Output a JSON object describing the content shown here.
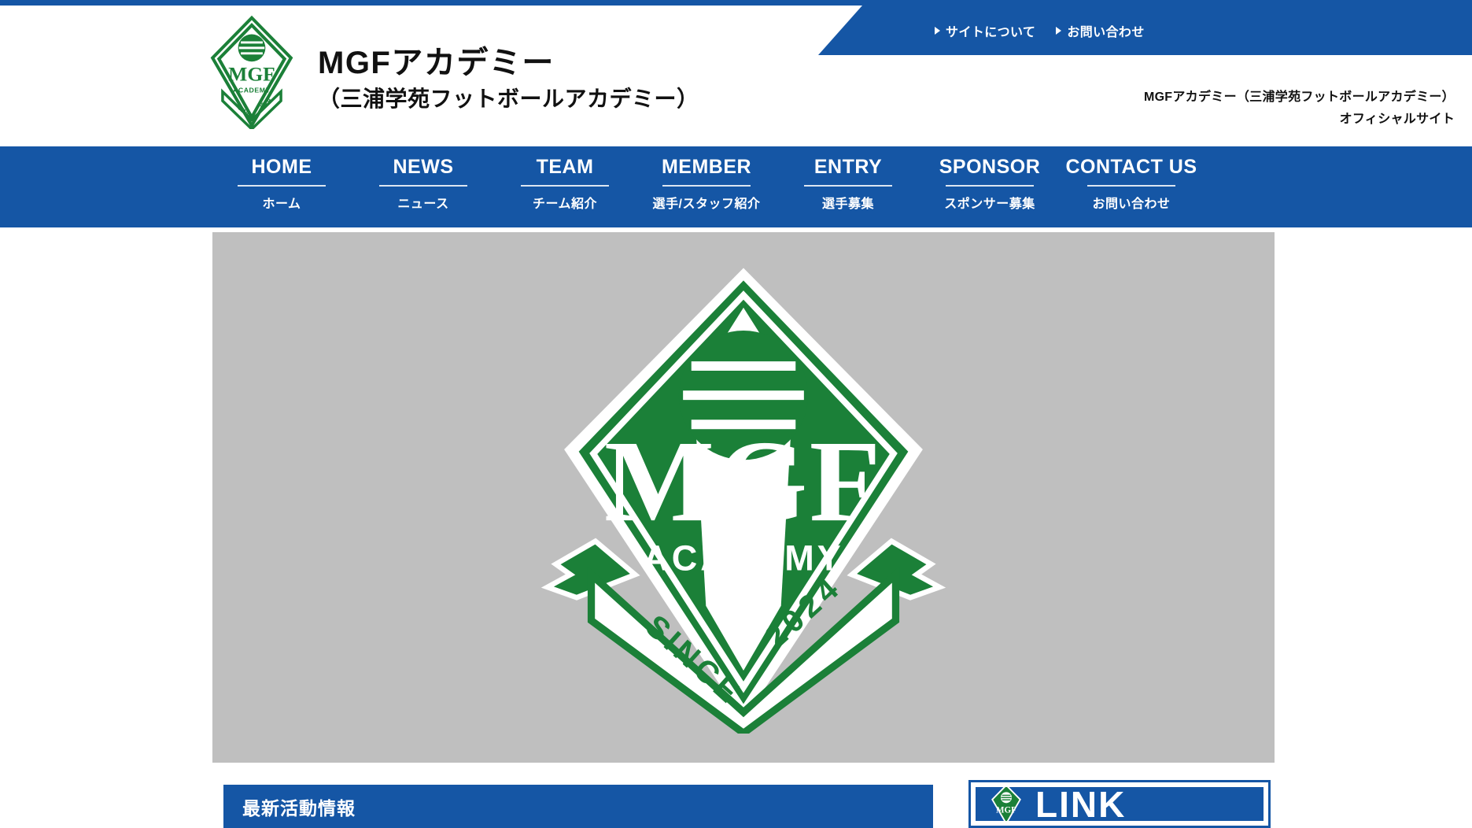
{
  "colors": {
    "brand_blue": "#1556A5",
    "crest_green": "#1B8038",
    "hero_bg": "#BFBFBF",
    "text_dark": "#111111",
    "white": "#FFFFFF"
  },
  "topbar": {
    "links": [
      {
        "label": "サイトについて",
        "icon": "triangle-right-icon"
      },
      {
        "label": "お問い合わせ",
        "icon": "triangle-right-icon"
      }
    ]
  },
  "header": {
    "logo_alt": "MGF Academy crest",
    "title": "MGFアカデミー",
    "subtitle": "（三浦学苑フットボールアカデミー）",
    "official_line1": "MGFアカデミー（三浦学苑フットボールアカデミー）",
    "official_line2": "オフィシャルサイト"
  },
  "nav": {
    "items": [
      {
        "en": "HOME",
        "jp": "ホーム"
      },
      {
        "en": "NEWS",
        "jp": "ニュース"
      },
      {
        "en": "TEAM",
        "jp": "チーム紹介"
      },
      {
        "en": "MEMBER",
        "jp": "選手/スタッフ紹介"
      },
      {
        "en": "ENTRY",
        "jp": "選手募集"
      },
      {
        "en": "SPONSOR",
        "jp": "スポンサー募集"
      },
      {
        "en": "CONTACT US",
        "jp": "お問い合わせ"
      }
    ]
  },
  "hero": {
    "crest": {
      "monogram": "MGF",
      "academy_text": "ACADEMY",
      "since_text": "SINCE",
      "year_text": "2024"
    }
  },
  "latest": {
    "title": "最新活動情報"
  },
  "link_panel": {
    "title": "LINK",
    "logo_alt": "MGF Academy crest small"
  }
}
